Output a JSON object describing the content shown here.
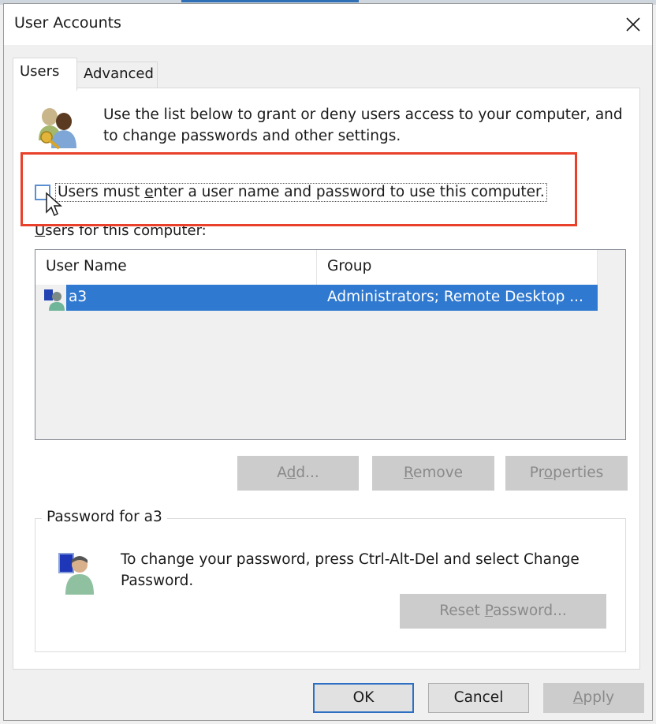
{
  "window": {
    "title": "User Accounts",
    "close_icon": "close-icon"
  },
  "tabs": [
    {
      "label": "Users",
      "active": true
    },
    {
      "label": "Advanced",
      "active": false
    }
  ],
  "users_tab": {
    "intro_icon": "users-key-icon",
    "intro_text": "Use the list below to grant or deny users access to your computer, and to change passwords and other settings.",
    "require_login_checkbox": {
      "label_prefix": "Users must ",
      "label_mnemonic": "e",
      "label_suffix": "nter a user name and password to use this computer.",
      "checked": false
    },
    "users_label": {
      "mnemonic": "U",
      "rest": "sers for this computer:"
    },
    "list": {
      "columns": [
        "User Name",
        "Group"
      ],
      "rows": [
        {
          "icon": "user-account-icon",
          "user_name": "a3",
          "group": "Administrators; Remote Desktop ...",
          "selected": true
        }
      ]
    },
    "buttons": {
      "add": {
        "pre": "A",
        "mnemonic": "d",
        "post": "d...",
        "enabled": false
      },
      "remove": {
        "pre": "",
        "mnemonic": "R",
        "post": "emove",
        "enabled": false
      },
      "properties": {
        "pre": "Pr",
        "mnemonic": "o",
        "post": "perties",
        "enabled": false
      }
    },
    "password_group": {
      "title": "Password for a3",
      "icon": "user-password-icon",
      "text": "To change your password, press Ctrl-Alt-Del and select Change Password.",
      "reset_button": {
        "pre": "Reset ",
        "mnemonic": "P",
        "post": "assword...",
        "enabled": false
      }
    }
  },
  "footer": {
    "ok": {
      "label": "OK",
      "default": true
    },
    "cancel": {
      "label": "Cancel"
    },
    "apply": {
      "mnemonic": "A",
      "post": "pply",
      "enabled": false
    }
  },
  "annotation": {
    "highlight_color": "#e8402a"
  },
  "colors": {
    "selection": "#3079d0",
    "checkbox_border": "#5a8fd0",
    "default_button_border": "#2d6fc2"
  }
}
